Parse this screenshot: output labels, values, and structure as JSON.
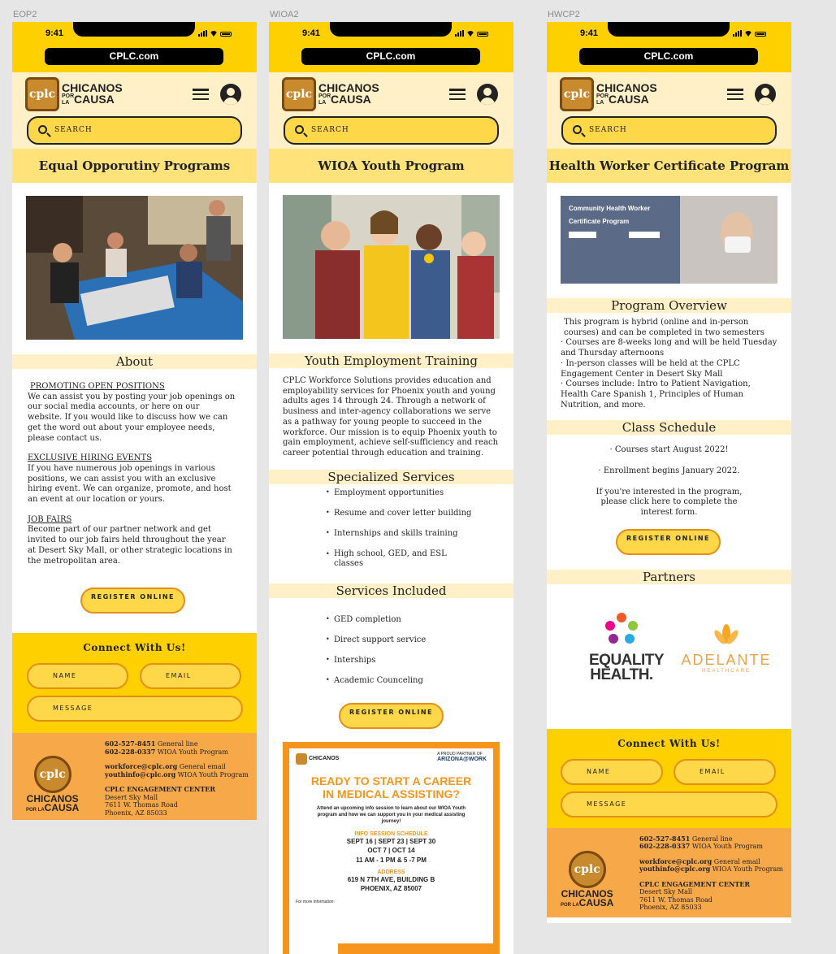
{
  "labels": {
    "eop": "EOP2",
    "wioa": "WIOA2",
    "hwc": "HWCP2"
  },
  "status": {
    "time": "9:41",
    "url": "CPLC.com"
  },
  "header": {
    "logo_line1": "CHICANOS",
    "logo_small": "POR LA",
    "logo_line2": "CAUSA",
    "search": "SEARCH"
  },
  "eop": {
    "title": "Equal Opporutiny Programs",
    "about": "About",
    "h1": "PROMOTING OPEN POSITIONS",
    "p1": "We can assist you by posting your job openings on our social media accounts, or here on our website. If you would like to discuss how we can get the word out about your employee needs, please contact us.",
    "h2": "EXCLUSIVE HIRING EVENTS",
    "p2": "If you have numerous job openings in various positions, we can assist you with an exclusive hiring event. We can organize, promote, and host an event at our location or yours.",
    "h3": "JOB FAIRS",
    "p3": "Become part of our partner network and get invited to our job fairs held throughout the year at Desert Sky Mall, or other strategic locations in the metropolitan area.",
    "register": "REGISTER ONLINE"
  },
  "wioa": {
    "title": "WIOA Youth Program",
    "sect1": "Youth Employment Training",
    "p1": "CPLC Workforce Solutions provides education and employability services for Phoenix youth and young adults ages 14 through 24.  Through a network of business and inter-agency collaborations we serve as a pathway for young people to succeed in the workforce. Our mission is to equip Phoenix youth to gain employment, achieve self-sufficiency and reach career potential through education and training.",
    "sect2": "Specialized Services",
    "services": [
      "Employment opportunities",
      "Resume and cover letter building",
      "Internships and skills training",
      "High school, GED, and ESL classes"
    ],
    "sect3": "Services Included",
    "included": [
      "GED completion",
      "Direct support service",
      "Interships",
      "Academic Counceling"
    ],
    "register": "REGISTER ONLINE",
    "flyer": {
      "partner": "A PROUD PARTNER OF",
      "az": "ARIZONA@WORK",
      "headline": "READY TO START A CAREER IN MEDICAL ASSISTING?",
      "sub": "Attend an upcoming info session to learn about our WIOA Youth program and how we can support you in your medical assisting journey!",
      "schedule_h": "INFO SESSION SCHEDULE",
      "dates1": "SEPT 16 | SEPT 23 | SEPT 30",
      "dates2": "OCT 7 | OCT 14",
      "times": "11 AM - 1 PM & 5 -7 PM",
      "addr_h": "ADDRESS",
      "addr1": "619 N 7TH AVE, BUILDING B",
      "addr2": "PHOENIX, AZ 85007",
      "more": "For more information:"
    }
  },
  "hwc": {
    "title": "Health Worker Certificate Program",
    "banner1": "Community Health Worker",
    "banner2": "Certificate Program",
    "overview": "Program Overview",
    "o1": "This program is hybrid (online and in-person courses) and can be completed in two semesters",
    "o2": "Courses are 8-weeks long and will be held Tuesday and Thursday afternoons",
    "o3": "In-person classes will be held at the CPLC Engagement Center in Desert Sky Mall",
    "o4": "Courses include: Intro to Patient Navigation, Health Care Spanish 1, Principles of Human Nutrition, and more.",
    "schedule": "Class Schedule",
    "s1": "Courses start August 2022!",
    "s2": "Enrollment begins January 2022.",
    "s3": "If you're interested in the program, please click here to complete the interest form.",
    "register": "REGISTER ONLINE",
    "partners": "Partners",
    "p1a": "EQUALITY",
    "p1b": "HEALTH.",
    "p2a": "ADELANTE",
    "p2b": "HEALTHCARE"
  },
  "connect": {
    "title": "Connect With Us!",
    "name": "NAME",
    "email": "EMAIL",
    "message": "MESSAGE"
  },
  "footer": {
    "ph1": "602-527-8451",
    "ph1l": "General line",
    "ph2": "602-228-0337",
    "ph2l": "WIOA Youth Program",
    "em1": "workforce@cplc.org",
    "em1l": "General email",
    "em2": "youthinfo@cplc.org",
    "em2l": "WIOA Youth Program",
    "center": "CPLC ENGAGEMENT CENTER",
    "a1": "Desert Sky Mall",
    "a2": "7611 W. Thomas Road",
    "a3": "Phoenix, AZ 85033",
    "brand1": "CHICANOS",
    "brand_small": "POR LA",
    "brand2": "CAUSA"
  },
  "colors": {
    "yellow": "#ffd000",
    "cream": "#fff0c8",
    "orange": "#f7a94a"
  }
}
